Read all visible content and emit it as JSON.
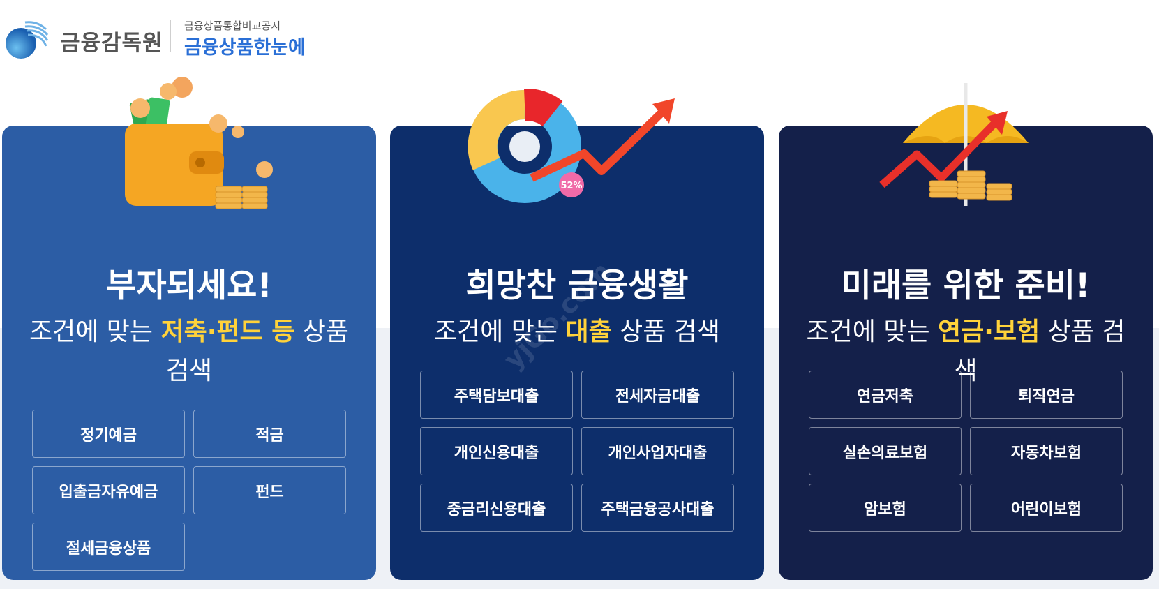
{
  "header": {
    "org_name": "금융감독원",
    "sub_top": "금융상품통합비교공시",
    "sub_main": "금융상품한눈에"
  },
  "cards": [
    {
      "title": "부자되세요!",
      "desc_pre": "조건에 맞는 ",
      "desc_highlight": "저축·펀드 등",
      "desc_post": " 상품 검색",
      "buttons": [
        "정기예금",
        "적금",
        "입출금자유예금",
        "펀드",
        "절세금융상품"
      ]
    },
    {
      "title": "희망찬 금융생활",
      "desc_pre": "조건에 맞는 ",
      "desc_highlight": "대출",
      "desc_post": " 상품 검색",
      "badge": "52%",
      "buttons": [
        "주택담보대출",
        "전세자금대출",
        "개인신용대출",
        "개인사업자대출",
        "중금리신용대출",
        "주택금융공사대출"
      ]
    },
    {
      "title": "미래를 위한 준비!",
      "desc_pre": "조건에 맞는 ",
      "desc_highlight": "연금·보험",
      "desc_post": " 상품 검색",
      "buttons": [
        "연금저축",
        "퇴직연금",
        "실손의료보험",
        "자동차보험",
        "암보험",
        "어린이보험"
      ]
    }
  ],
  "watermark": "yjGo.com",
  "colors": {
    "card1_bg": "#2c5da5",
    "card2_bg": "#0d2e6b",
    "card3_bg": "#14204a",
    "highlight": "#ffd23a",
    "brand_blue": "#2a6fd6"
  },
  "icons": [
    "fss-globe-logo",
    "wallet-coins-illustration",
    "donut-chart-arrow-illustration",
    "umbrella-coins-arrow-illustration"
  ]
}
